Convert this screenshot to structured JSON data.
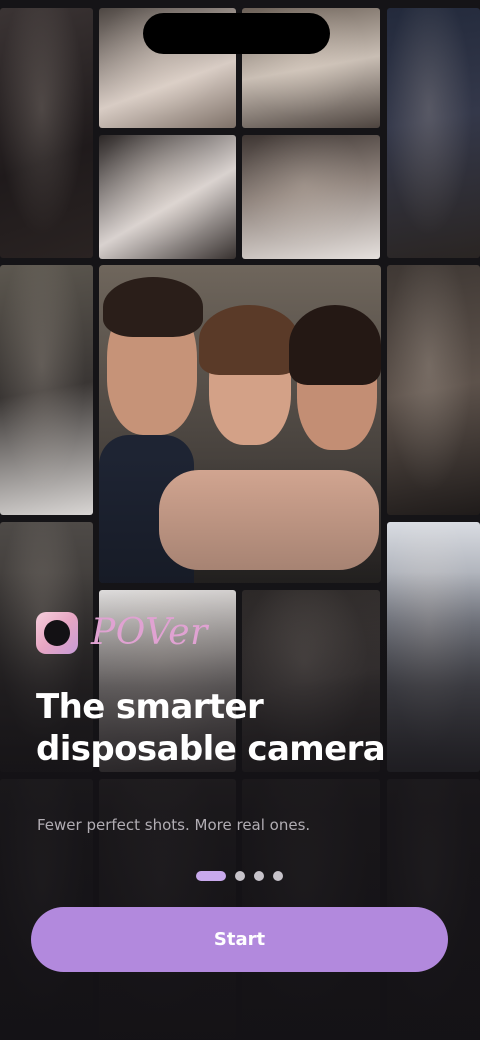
{
  "brand": {
    "name": "POVer",
    "icon": "camera-lens-icon"
  },
  "headline": "The smarter disposable camera",
  "subtitle": "Fewer perfect shots. More real ones.",
  "pager": {
    "pages": 4,
    "active": 1
  },
  "start_label": "Start",
  "colors": {
    "accent": "#B289DD",
    "active_dot": "#C8A9EC",
    "brand_text": "#E0A2D2",
    "background": "#1B1A1D"
  }
}
